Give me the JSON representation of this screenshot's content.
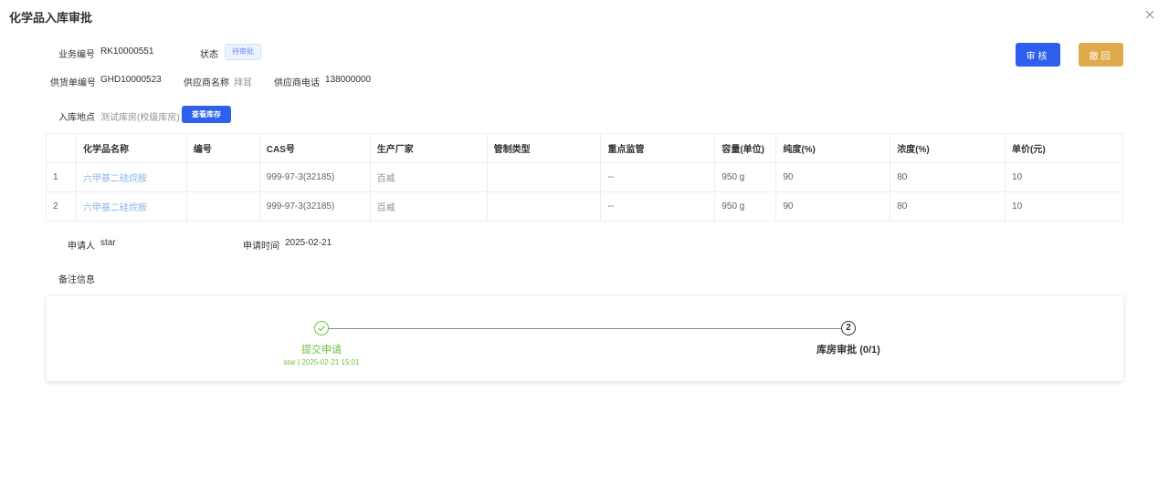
{
  "dialog": {
    "title": "化学品入库审批"
  },
  "info": {
    "business_no_label": "业务编号",
    "business_no": "RK10000551",
    "status_label": "状态",
    "status": "待审批",
    "supply_no_label": "供货单编号",
    "supply_no": "GHD10000523",
    "supplier_name_label": "供应商名称",
    "supplier_name": "拜耳",
    "supplier_phone_label": "供应商电话",
    "supplier_phone": "138000000",
    "location_label": "入库地点",
    "location": "测试库房(校级库房)",
    "view_inventory_button": "查看库存"
  },
  "actions": {
    "audit": "审核",
    "withdraw": "撤回"
  },
  "table": {
    "headers": [
      "",
      "化学品名称",
      "编号",
      "CAS号",
      "生产厂家",
      "管制类型",
      "重点监管",
      "容量(单位)",
      "纯度(%)",
      "浓度(%)",
      "单价(元)"
    ],
    "rows": [
      [
        "1",
        "六甲基二硅烷胺",
        "",
        "999-97-3(32185)",
        "百威",
        "",
        "--",
        "950 g",
        "90",
        "80",
        "10"
      ],
      [
        "2",
        "六甲基二硅烷胺",
        "",
        "999-97-3(32185)",
        "百威",
        "",
        "--",
        "950 g",
        "90",
        "80",
        "10"
      ]
    ]
  },
  "applicant": {
    "applicant_label": "申请人",
    "applicant": "star",
    "apply_time_label": "申请时间",
    "apply_time": "2025-02-21"
  },
  "remark": {
    "label": "备注信息"
  },
  "steps": [
    {
      "title": "提交申请",
      "desc": "star | 2025-02-21 15:01",
      "status": "done",
      "color": "#67c23a"
    },
    {
      "number": "2",
      "title": "库房审批 (0/1)",
      "status": "current"
    }
  ],
  "colors": {
    "primary": "#2f5fed",
    "warning": "#e0a94a",
    "success": "#67c23a",
    "link": "#8ab4ea"
  }
}
